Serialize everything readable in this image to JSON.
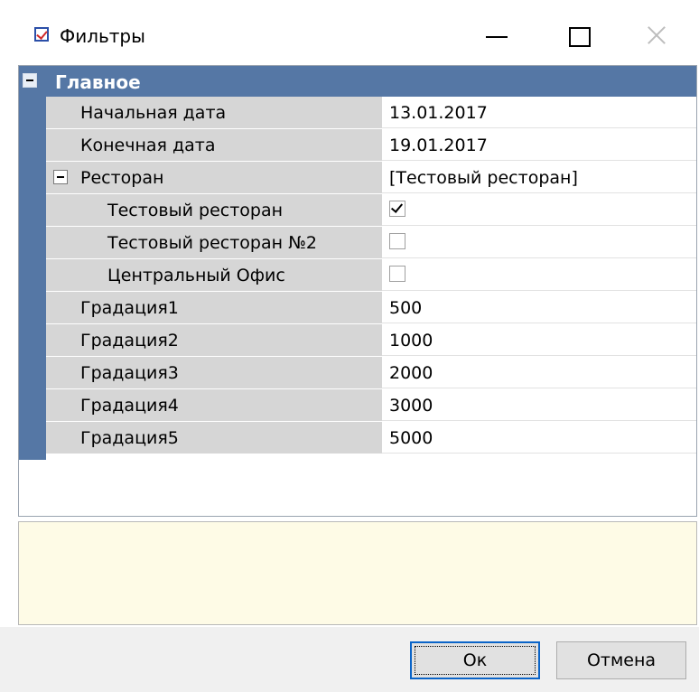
{
  "window": {
    "title": "Фильтры",
    "icon": "checkbox-icon"
  },
  "category": {
    "label": "Главное",
    "expanded": true
  },
  "properties": [
    {
      "label": "Начальная дата",
      "value": "13.01.2017"
    },
    {
      "label": "Конечная дата",
      "value": "19.01.2017"
    },
    {
      "label": "Ресторан",
      "value": "[Тестовый ресторан]",
      "expanded": true
    },
    {
      "label": "Тестовый ресторан",
      "checked": true
    },
    {
      "label": "Тестовый ресторан №2",
      "checked": false
    },
    {
      "label": "Центральный Офис",
      "checked": false
    },
    {
      "label": "Градация1",
      "value": "500"
    },
    {
      "label": "Градация2",
      "value": "1000"
    },
    {
      "label": "Градация3",
      "value": "2000"
    },
    {
      "label": "Градация4",
      "value": "3000"
    },
    {
      "label": "Градация5",
      "value": "5000"
    }
  ],
  "buttons": {
    "ok": "Ок",
    "cancel": "Отмена"
  },
  "colors": {
    "category_bar": "#5577a5",
    "name_cell": "#d6d6d6",
    "description_panel": "#fefbe6",
    "focus_border": "#0a64c8"
  }
}
